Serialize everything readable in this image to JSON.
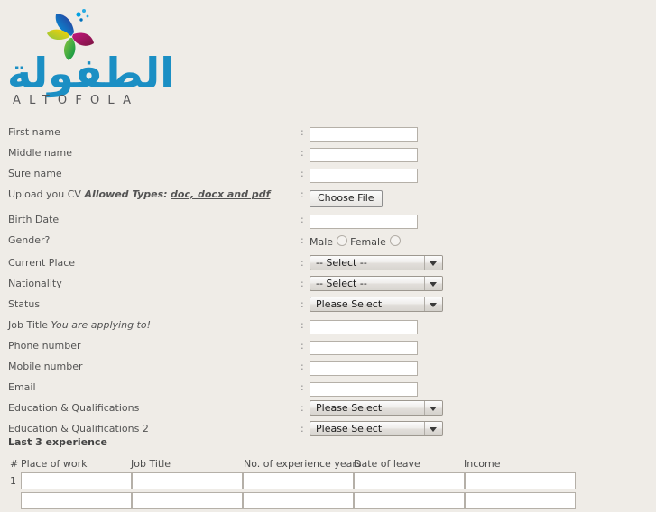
{
  "logo": {
    "arabic_text": "الطفولة",
    "latin_text": "ALTOFOLA",
    "arabic_color": "#1b8fc4",
    "latin_color": "#58585a",
    "petal_colors": [
      "#2e3192",
      "#00a0e3",
      "#a3195b",
      "#c4157e",
      "#8dc63f",
      "#39b54a",
      "#ffd200"
    ]
  },
  "page": {
    "background_color": "#efece7"
  },
  "form": {
    "separator": ":",
    "rows": [
      {
        "label": "First name",
        "control": "text",
        "value": ""
      },
      {
        "label": "Middle name",
        "control": "text",
        "value": ""
      },
      {
        "label": "Sure name",
        "control": "text",
        "value": ""
      },
      {
        "label": "Upload you CV",
        "label_bold_italic": "Allowed Types:",
        "label_bold_italic_underline": "doc, docx and pdf",
        "control": "file",
        "file_button_label": "Choose File"
      },
      {
        "label": "Birth Date",
        "control": "text",
        "value": ""
      },
      {
        "label": "Gender?",
        "control": "radio",
        "options": [
          "Male",
          "Female"
        ],
        "selected": ""
      },
      {
        "label": "Current Place",
        "control": "select",
        "value": "-- Select --"
      },
      {
        "label": "Nationality",
        "control": "select",
        "value": "-- Select --"
      },
      {
        "label": "Status",
        "control": "select",
        "value": "Please Select"
      },
      {
        "label": "Job Title",
        "label_italic": "You are applying to!",
        "control": "text",
        "value": ""
      },
      {
        "label": "Phone number",
        "control": "text",
        "value": ""
      },
      {
        "label": "Mobile number",
        "control": "text",
        "value": ""
      },
      {
        "label": "Email",
        "control": "text",
        "value": ""
      },
      {
        "label": "Education & Qualifications",
        "control": "select",
        "value": "Please Select"
      },
      {
        "label": "Education & Qualifications 2",
        "control": "select",
        "value": "Please Select"
      }
    ]
  },
  "experience": {
    "section_title": "Last 3 experience",
    "columns": [
      "#",
      "Place of work",
      "Job Title",
      "No. of experience years",
      "Date of leave",
      "Income"
    ],
    "rows": [
      {
        "num": "1",
        "place_of_work": "",
        "job_title": "",
        "years": "",
        "date_of_leave": "",
        "income": ""
      }
    ]
  }
}
